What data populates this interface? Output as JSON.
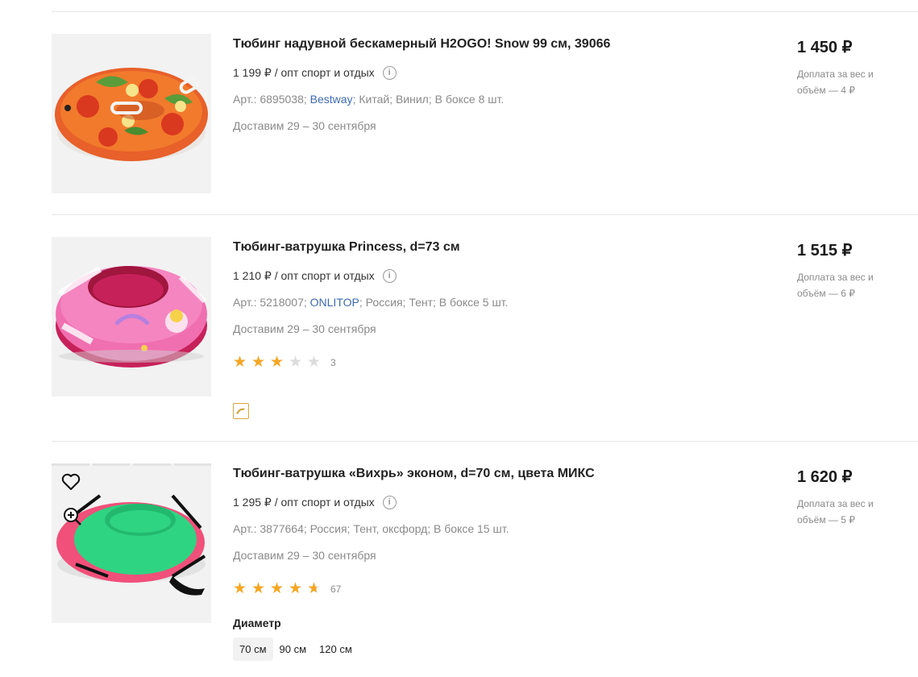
{
  "colors": {
    "accent_star": "#f5a623",
    "brand_link": "#3d6bb3",
    "muted": "#8a8a8a"
  },
  "products": [
    {
      "title": "Тюбинг надувной бескамерный H2OGO! Snow 99 см, 39066",
      "opt_price": "1 199 ₽ / опт спорт и отдых",
      "art": "Арт.: 6895038;",
      "brand": "Bestway",
      "meta_rest": "; Китай; Винил; В боксе 8 шт.",
      "delivery": "Доставим 29 – 30 сентября",
      "price": "1 450 ₽",
      "surcharge": "Доплата за вес и объём — 4 ₽",
      "image": "pizza-tube-image"
    },
    {
      "title": "Тюбинг-ватрушка Princess, d=73 см",
      "opt_price": "1 210 ₽ / опт спорт и отдых",
      "art": "Арт.: 5218007;",
      "brand": "ONLITOP",
      "meta_rest": "; Россия; Тент; В боксе 5 шт.",
      "delivery": "Доставим 29 – 30 сентября",
      "price": "1 515 ₽",
      "surcharge": "Доплата за вес и объём — 6 ₽",
      "rating": 3,
      "rating_count": "3",
      "image": "princess-tube-image",
      "badge_icon": "dolphin-badge-icon"
    },
    {
      "title": "Тюбинг-ватрушка «Вихрь» эконом, d=70 см, цвета МИКС",
      "opt_price": "1 295 ₽ / опт спорт и отдых",
      "meta": "Арт.: 3877664; Россия; Тент, оксфорд; В боксе 15 шт.",
      "delivery": "Доставим 29 – 30 сентября",
      "price": "1 620 ₽",
      "surcharge": "Доплата за вес и объём — 5 ₽",
      "rating": 4.5,
      "rating_count": "67",
      "image": "vikhr-tube-image",
      "diameter_label": "Диаметр",
      "sizes": [
        "70 см",
        "90 см",
        "120 см"
      ],
      "selected_size": "70 см"
    }
  ]
}
